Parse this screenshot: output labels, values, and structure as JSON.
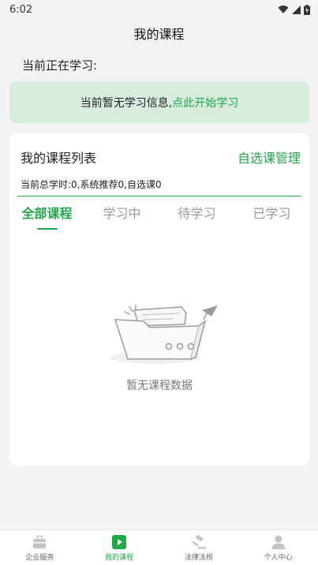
{
  "status_bar": {
    "time": "6:02"
  },
  "header": {
    "title": "我的课程"
  },
  "current_study": {
    "label": "当前正在学习:"
  },
  "banner": {
    "text": "当前暂无学习信息,",
    "link": "点此开始学习"
  },
  "course_list": {
    "title": "我的课程列表",
    "manage_link": "自选课管理",
    "summary": "当前总学时:0,系统推荐0,自选课0",
    "tabs": [
      {
        "label": "全部课程",
        "active": true
      },
      {
        "label": "学习中"
      },
      {
        "label": "待学习"
      },
      {
        "label": "已学习"
      }
    ],
    "empty_text": "暂无课程数据"
  },
  "bottom_nav": {
    "items": [
      {
        "label": "企业服务",
        "icon": "briefcase-icon"
      },
      {
        "label": "我的课程",
        "icon": "play-icon",
        "active": true
      },
      {
        "label": "法律法规",
        "icon": "gavel-icon"
      },
      {
        "label": "个人中心",
        "icon": "person-icon"
      }
    ]
  },
  "colors": {
    "accent": "#21a648",
    "banner_bg": "#d7ecdd"
  }
}
